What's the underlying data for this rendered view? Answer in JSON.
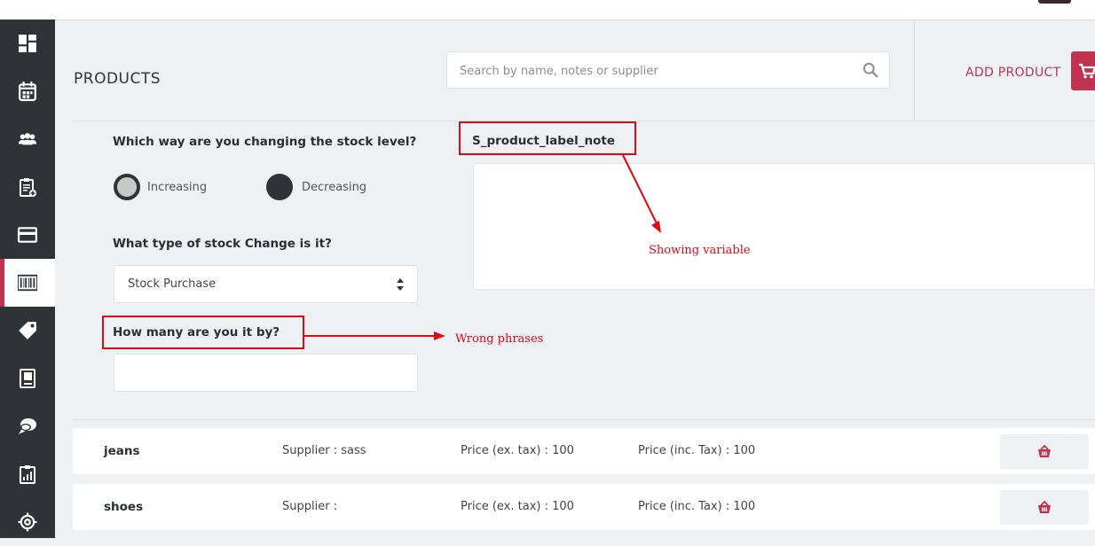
{
  "page": {
    "title": "PRODUCTS"
  },
  "search": {
    "placeholder": "Search by name, notes or supplier",
    "value": ""
  },
  "header": {
    "add_product_label": "ADD PRODUCT"
  },
  "sidebar": {
    "items": [
      {
        "icon": "dashboard-icon",
        "active": false
      },
      {
        "icon": "calendar-icon",
        "active": false
      },
      {
        "icon": "users-icon",
        "active": false
      },
      {
        "icon": "clipboard-add-icon",
        "active": false
      },
      {
        "icon": "credit-card-icon",
        "active": false
      },
      {
        "icon": "barcode-icon",
        "active": true
      },
      {
        "icon": "tag-icon",
        "active": false
      },
      {
        "icon": "book-icon",
        "active": false
      },
      {
        "icon": "chat-icon",
        "active": false
      },
      {
        "icon": "report-icon",
        "active": false
      },
      {
        "icon": "settings-icon",
        "active": false
      }
    ]
  },
  "stock_form": {
    "direction_question": "Which way are you changing the stock level?",
    "options": [
      {
        "label": "Increasing",
        "selected": false
      },
      {
        "label": "Decreasing",
        "selected": true
      }
    ],
    "type_question": "What type of stock Change is it?",
    "type_selected": "Stock Purchase",
    "amount_question": "How many are you it by?",
    "amount_value": "",
    "note_label": "S_product_label_note",
    "note_value": ""
  },
  "annotations": {
    "variable": "Showing variable",
    "phrase": "Wrong phrases"
  },
  "products": [
    {
      "name": "jeans",
      "supplier": "Supplier : sass",
      "price_ex": "Price (ex. tax) : 100",
      "price_inc": "Price (inc. Tax) : 100"
    },
    {
      "name": "shoes",
      "supplier": "Supplier :",
      "price_ex": "Price (ex. tax) : 100",
      "price_inc": "Price (inc. Tax) : 100"
    }
  ],
  "colors": {
    "accent": "#c0334f",
    "sidebar": "#2f3337",
    "annotation": "#e30613",
    "background": "#eef1f4"
  }
}
